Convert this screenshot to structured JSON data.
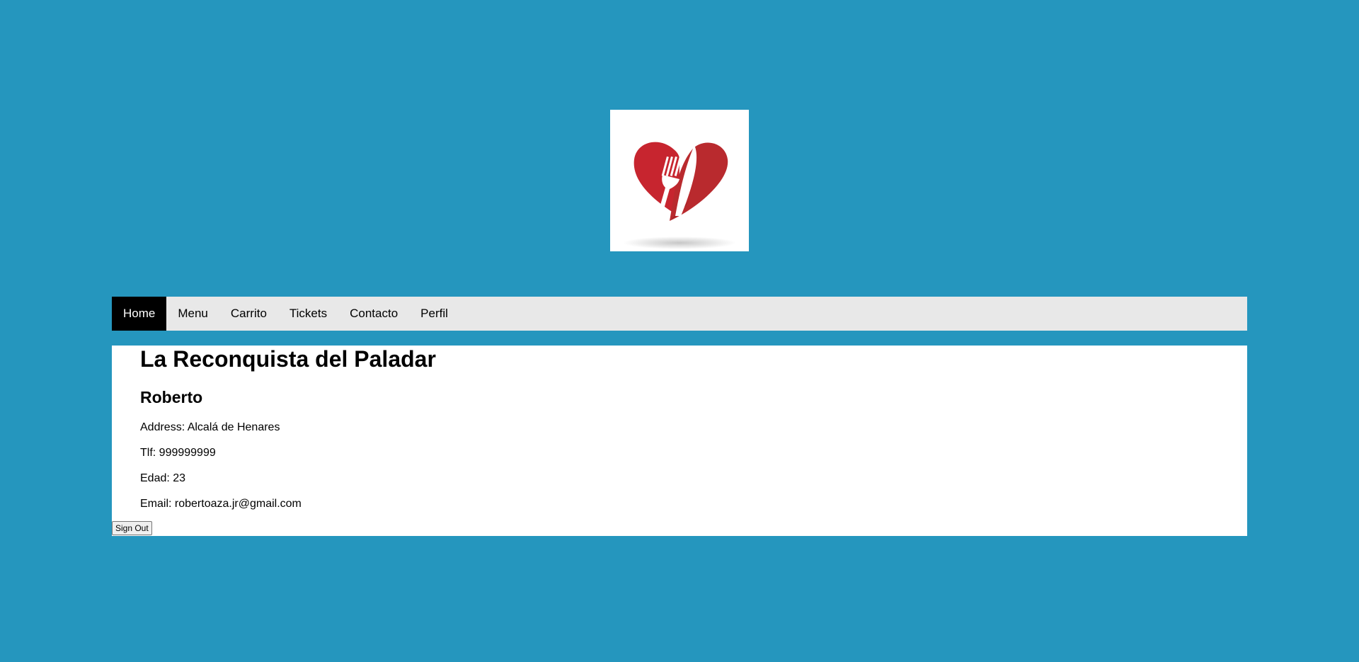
{
  "logo": {
    "icon": "heart-fork-knife-icon",
    "colors": {
      "heart": "#c7252f",
      "heart_dark": "#9e1b22"
    }
  },
  "nav": {
    "items": [
      {
        "label": "Home",
        "active": true
      },
      {
        "label": "Menu",
        "active": false
      },
      {
        "label": "Carrito",
        "active": false
      },
      {
        "label": "Tickets",
        "active": false
      },
      {
        "label": "Contacto",
        "active": false
      },
      {
        "label": "Perfil",
        "active": false
      }
    ]
  },
  "profile": {
    "title": "La Reconquista del Paladar",
    "name": "Roberto",
    "address": "Address: Alcalá de Henares",
    "tlf": "Tlf: 999999999",
    "edad": "Edad: 23",
    "email": "Email: robertoaza.jr@gmail.com",
    "signout_label": "Sign Out"
  },
  "colors": {
    "background": "#2596be",
    "nav_bg": "#e8e8e8",
    "nav_active": "#000000"
  }
}
